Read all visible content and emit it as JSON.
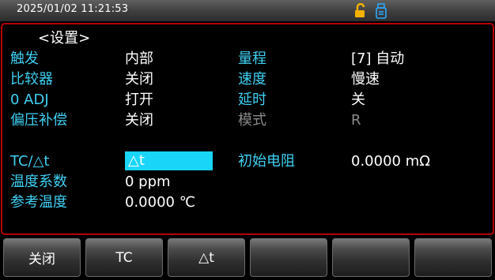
{
  "statusbar": {
    "datetime": "2025/01/02  11:21:53",
    "icons": [
      "unlock-icon",
      "usb-storage-icon"
    ],
    "icon_colors": {
      "lock": "#f2b200",
      "usb": "#2aa9ff"
    }
  },
  "screen_title": "<设置>",
  "settings": {
    "trigger": {
      "label": "触发",
      "value": "内部"
    },
    "comparator": {
      "label": "比较器",
      "value": "关闭"
    },
    "zero_adj": {
      "label": "0 ADJ",
      "value": "打开"
    },
    "bias_comp": {
      "label": "偏压补偿",
      "value": "关闭"
    },
    "range": {
      "label": "量程",
      "value": "[7] 自动"
    },
    "speed": {
      "label": "速度",
      "value": "慢速"
    },
    "delay": {
      "label": "延时",
      "value": "关"
    },
    "mode": {
      "label": "模式",
      "value": "R"
    }
  },
  "temperature": {
    "tc_mode": {
      "label": "TC/△t",
      "value": "△t"
    },
    "temp_coeff": {
      "label": "温度系数",
      "value": "0 ppm"
    },
    "ref_temp": {
      "label": "参考温度",
      "value": "0.0000 ℃"
    },
    "init_resistance": {
      "label": "初始电阻",
      "value": "0.0000 mΩ"
    }
  },
  "softkeys": [
    {
      "label": "关闭"
    },
    {
      "label": "TC"
    },
    {
      "label": "△t"
    },
    {
      "label": ""
    },
    {
      "label": ""
    },
    {
      "label": ""
    }
  ],
  "colors": {
    "label": "#3fd0f2",
    "value": "#ffffff",
    "disabled": "#8a8a8a",
    "frame": "#b50000",
    "selected_bg": "#19d6f9"
  }
}
